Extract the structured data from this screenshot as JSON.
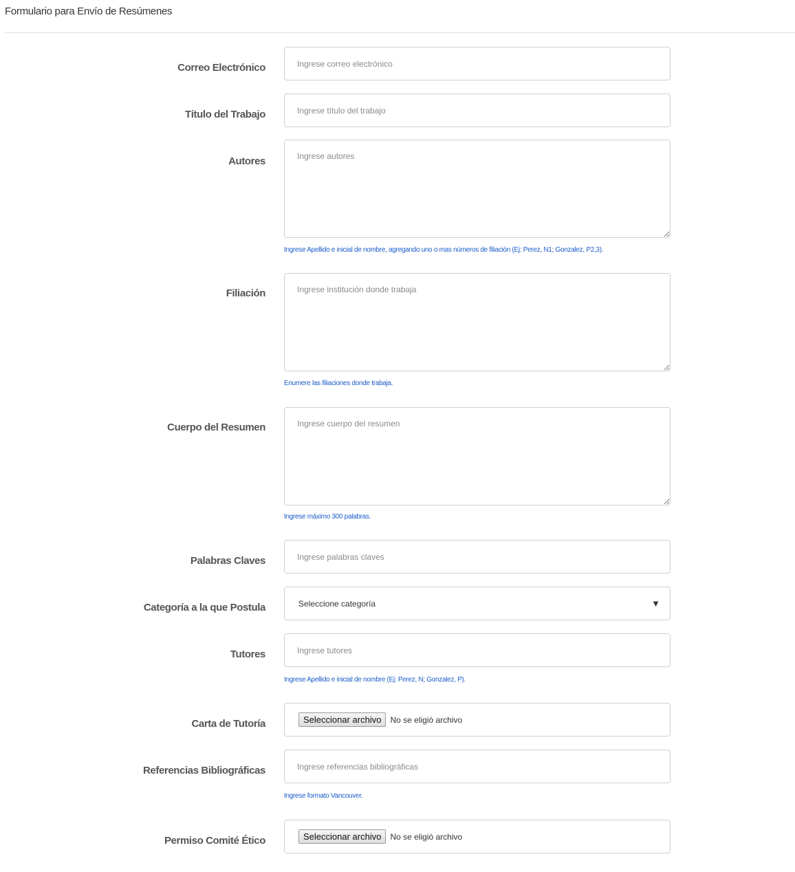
{
  "page": {
    "title": "Formulario para Envío de Resúmenes"
  },
  "form": {
    "email": {
      "label": "Correo Electrónico",
      "placeholder": "Ingrese correo electrónico"
    },
    "title": {
      "label": "Título del Trabajo",
      "placeholder": "Ingrese título del trabajo"
    },
    "authors": {
      "label": "Autores",
      "placeholder": "Ingrese autores",
      "help": "Ingrese Apellido e inicial de nombre, agregando uno o mas números de filiación (Ej: Perez, N1; Gonzalez, P2,3)."
    },
    "affiliation": {
      "label": "Filiación",
      "placeholder": "Ingrese institución donde trabaja",
      "help": "Enumere las filiaciones donde trabaja."
    },
    "abstract_body": {
      "label": "Cuerpo del Resumen",
      "placeholder": "Ingrese cuerpo del resumen",
      "help": "Ingrese máximo 300 palabras."
    },
    "keywords": {
      "label": "Palabras Claves",
      "placeholder": "Ingrese palabras claves"
    },
    "category": {
      "label": "Categoría a la que Postula",
      "selected": "Seleccione categoría"
    },
    "tutors": {
      "label": "Tutores",
      "placeholder": "Ingrese tutores",
      "help": "Ingrese Apellido e inicial de nombre (Ej: Perez, N; Gonzalez, P)."
    },
    "tutor_letter": {
      "label": "Carta de Tutoría",
      "button": "Seleccionar archivo",
      "status": "No se eligió archivo"
    },
    "references": {
      "label": "Referencias Bibliográficas",
      "placeholder": "Ingrese referencias bibliográficas",
      "help": "Ingrese formato Vancouver."
    },
    "ethics_permit": {
      "label": "Permiso Comité Ético",
      "button": "Seleccionar archivo",
      "status": "No se eligió archivo"
    }
  },
  "colors": {
    "help_text": "#1a5cc9",
    "border": "#cfcfcf"
  }
}
